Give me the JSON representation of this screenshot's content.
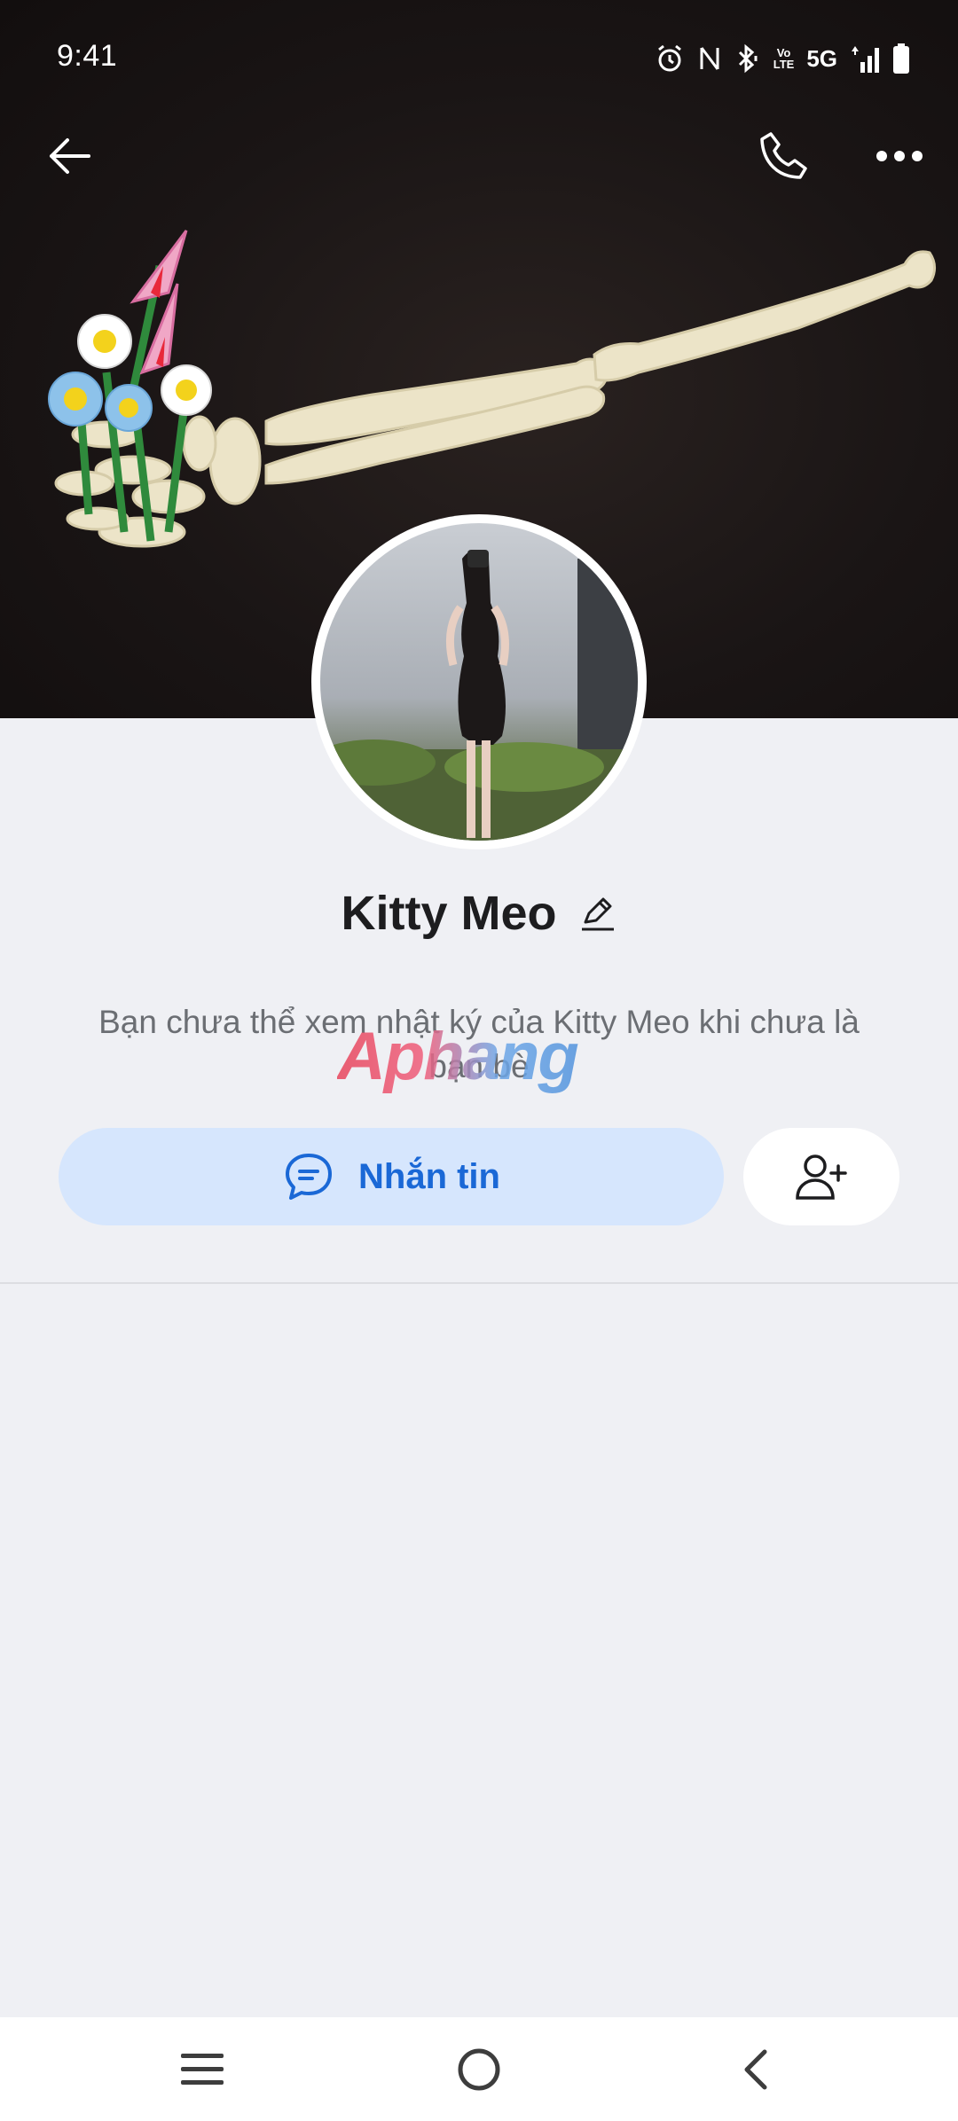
{
  "status_bar": {
    "time": "9:41",
    "network": "5G",
    "volte_top": "Vo",
    "volte_bottom": "LTE",
    "icons": [
      "alarm-icon",
      "nfc-icon",
      "bluetooth-icon",
      "volte-icon",
      "signal-icon",
      "battery-icon"
    ]
  },
  "header": {
    "back_icon": "arrow-left-icon",
    "call_icon": "phone-icon",
    "more_icon": "more-horizontal-icon"
  },
  "profile": {
    "name": "Kitty Meo",
    "edit_icon": "pencil-icon",
    "diary_notice": "Bạn chưa thể xem nhật ký của Kitty Meo khi chưa là bạn bè"
  },
  "watermark": "Aphang",
  "actions": {
    "message_label": "Nhắn tin",
    "message_icon": "chat-bubble-icon",
    "add_friend_icon": "user-plus-icon"
  },
  "system_nav": {
    "items": [
      "menu-icon",
      "home-icon",
      "back-icon"
    ]
  },
  "colors": {
    "accent": "#1a68d6",
    "message_bg": "#d6e6fd",
    "page_bg": "#eff0f4",
    "cover_bg": "#1a1515"
  }
}
